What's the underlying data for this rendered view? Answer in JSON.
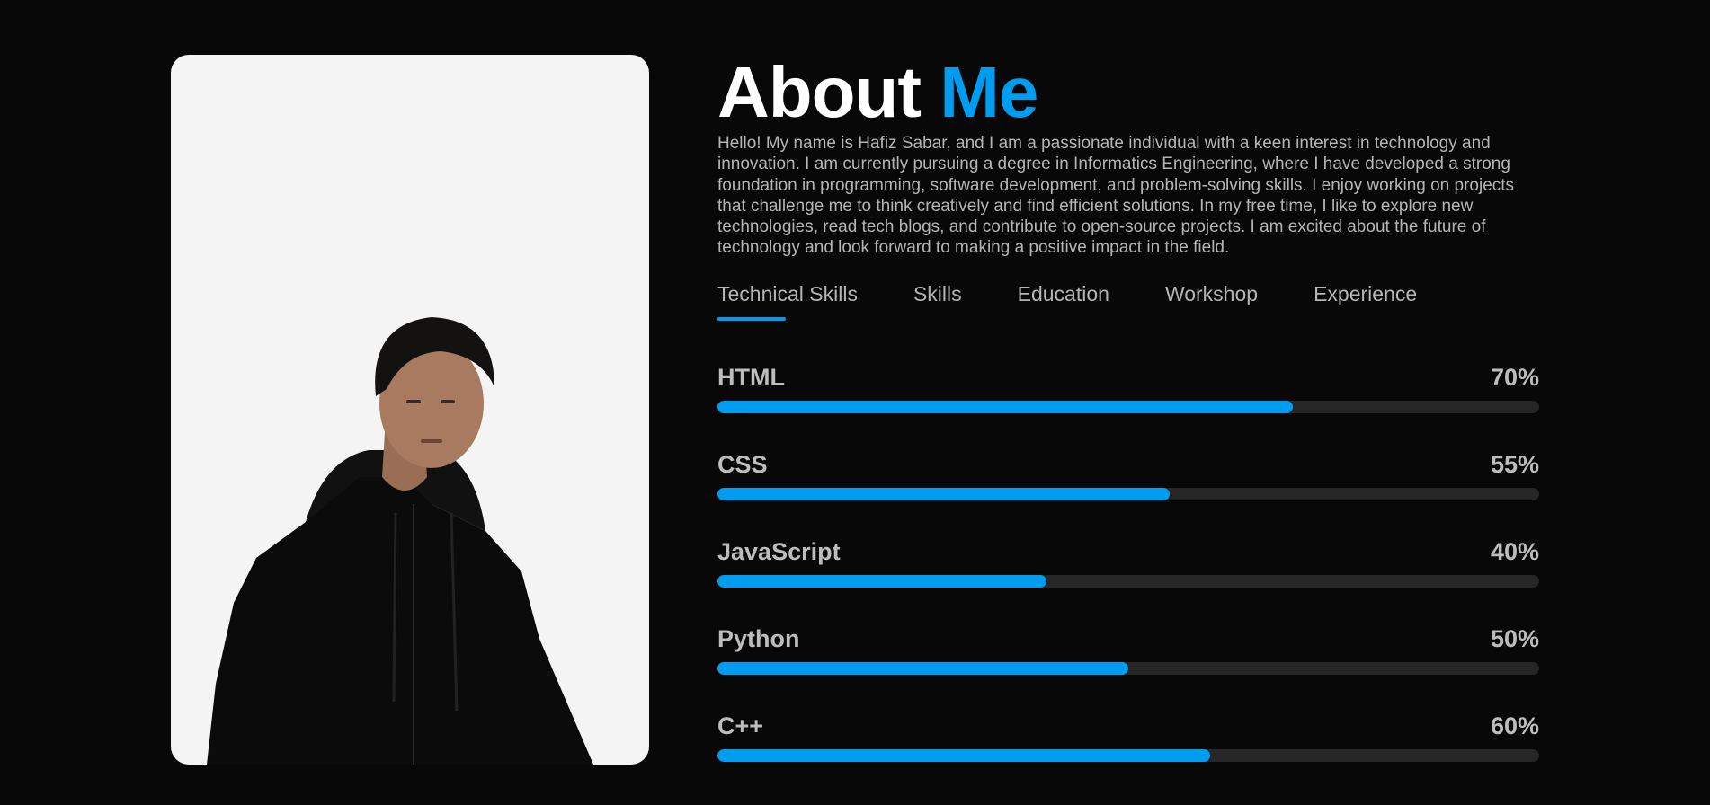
{
  "colors": {
    "accent": "#009cf0",
    "background": "#080808",
    "track": "#262626"
  },
  "about": {
    "title_part1": "About",
    "title_part2": "Me",
    "bio": "Hello! My name is Hafiz Sabar, and I am a passionate individual with a keen interest in technology and innovation. I am currently pursuing a degree in Informatics Engineering, where I have developed a strong foundation in programming, software development, and problem-solving skills. I enjoy working on projects that challenge me to think creatively and find efficient solutions. In my free time, I like to explore new technologies, read tech blogs, and contribute to open-source projects. I am excited about the future of technology and look forward to making a positive impact in the field."
  },
  "tabs": [
    {
      "label": "Technical Skills",
      "active": true
    },
    {
      "label": "Skills",
      "active": false
    },
    {
      "label": "Education",
      "active": false
    },
    {
      "label": "Workshop",
      "active": false
    },
    {
      "label": "Experience",
      "active": false
    }
  ],
  "skills": [
    {
      "name": "HTML",
      "percent_label": "70%",
      "progress": 0.7
    },
    {
      "name": "CSS",
      "percent_label": "55%",
      "progress": 0.55
    },
    {
      "name": "JavaScript",
      "percent_label": "40%",
      "progress": 0.4
    },
    {
      "name": "Python",
      "percent_label": "50%",
      "progress": 0.5
    },
    {
      "name": "C++",
      "percent_label": "60%",
      "progress": 0.6
    }
  ]
}
